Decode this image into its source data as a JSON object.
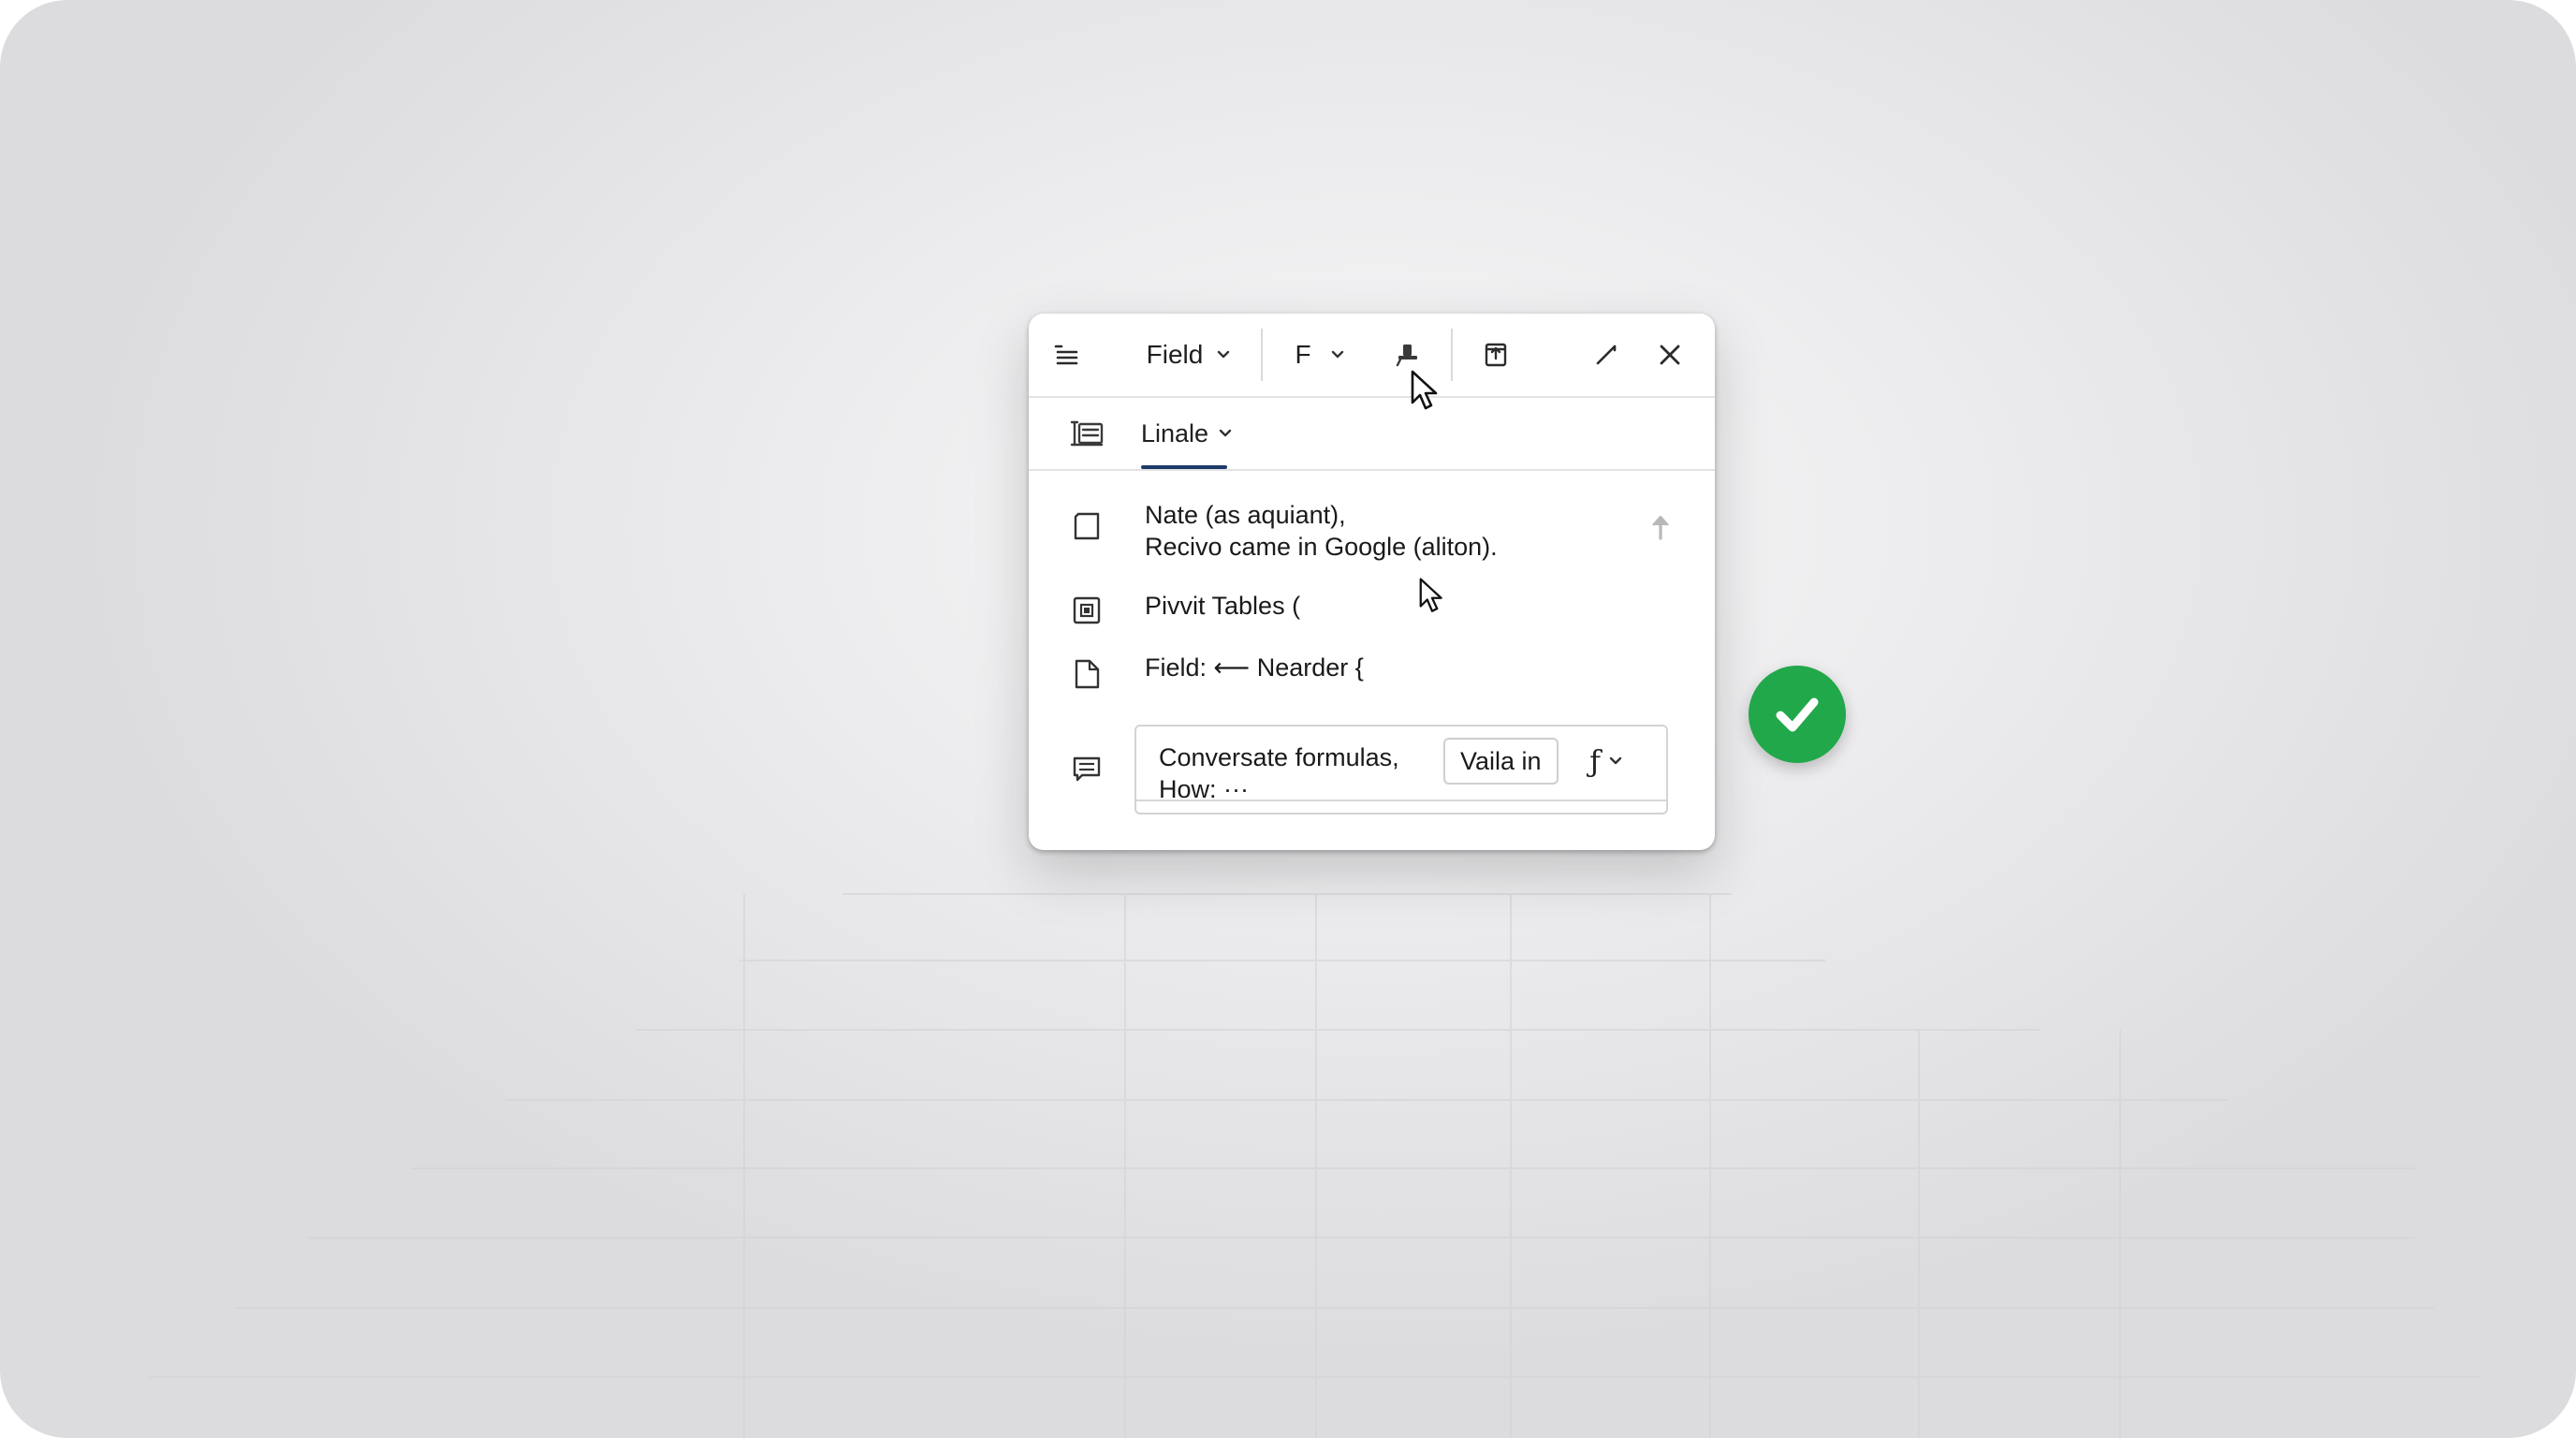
{
  "toolbar": {
    "menu_icon": "menu-lines-icon",
    "field_label": "Field",
    "font_label": "F",
    "format_painter_icon": "format-painter-icon",
    "export_icon": "export-icon",
    "expand_icon": "expand-icon",
    "close_icon": "close-icon"
  },
  "tab": {
    "icon": "list-outline-icon",
    "label": "Linale"
  },
  "items": [
    {
      "icon": "square-icon",
      "line1": "Nate (as aquiant),",
      "line2": "Recivo came in Google (aliton).",
      "action_icon": "arrow-up-icon"
    },
    {
      "icon": "pivot-table-icon",
      "line1": "Pivvit Tables ("
    },
    {
      "icon": "document-icon",
      "line1": "Field: ⟵ Nearder {"
    }
  ],
  "formula": {
    "icon": "comment-icon",
    "line1": "Conversate formulas,",
    "line2": "How: ···",
    "value_chip": "Vaila in",
    "function_glyph": "ƒ"
  },
  "status": {
    "badge_icon": "checkmark-icon",
    "color": "#21a84a"
  },
  "colors": {
    "tab_accent": "#1d3b68",
    "text": "#1a1a1a"
  }
}
